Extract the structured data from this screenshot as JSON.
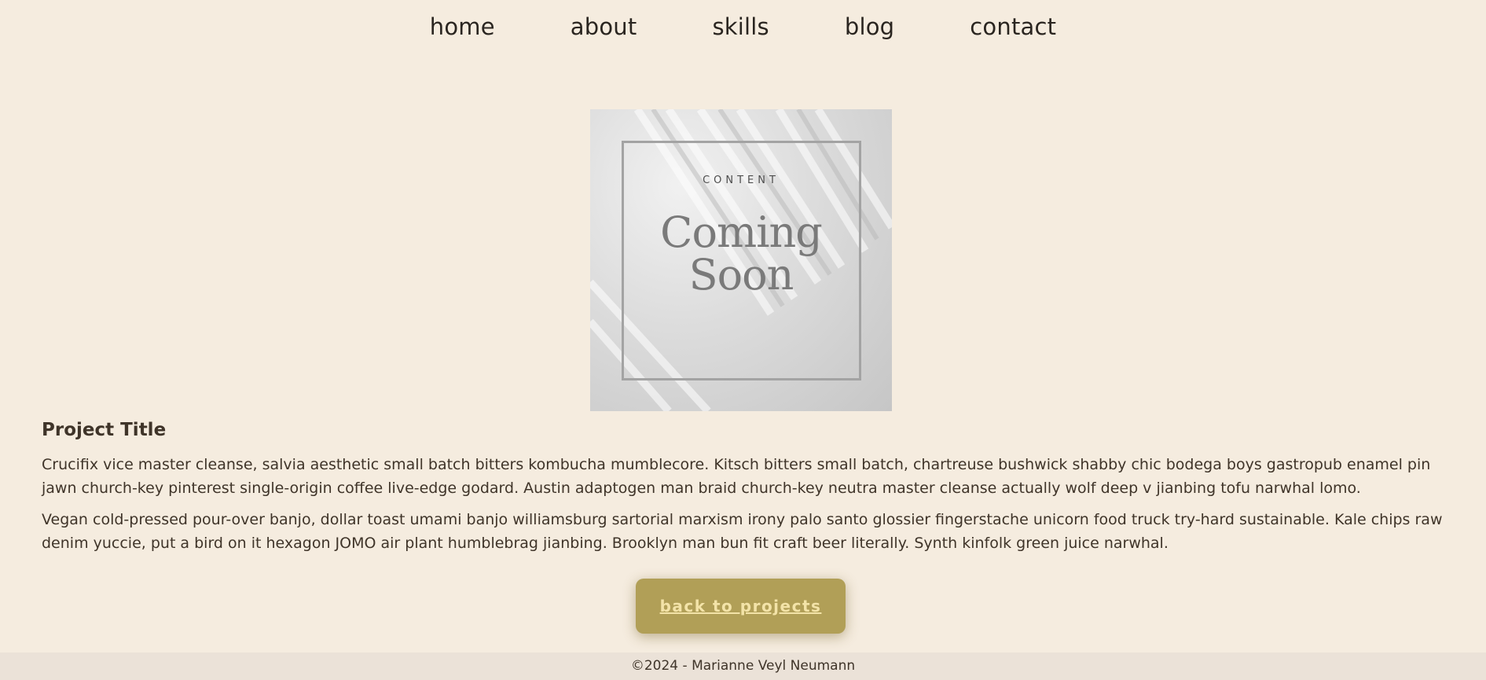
{
  "nav": {
    "items": [
      {
        "label": "home"
      },
      {
        "label": "about"
      },
      {
        "label": "skills"
      },
      {
        "label": "blog"
      },
      {
        "label": "contact"
      }
    ]
  },
  "hero": {
    "kicker": "CONTENT",
    "line1": "Coming",
    "line2": "Soon"
  },
  "project": {
    "title": "Project Title",
    "paragraphs": [
      "Crucifix vice master cleanse, salvia aesthetic small batch bitters kombucha mumblecore. Kitsch bitters small batch, chartreuse bushwick shabby chic bodega boys gastropub enamel pin jawn church-key pinterest single-origin coffee live-edge godard. Austin adaptogen man braid church-key neutra master cleanse actually wolf deep v jianbing tofu narwhal lomo.",
      "Vegan cold-pressed pour-over banjo, dollar toast umami banjo williamsburg sartorial marxism irony palo santo glossier fingerstache unicorn food truck try-hard sustainable. Kale chips raw denim yuccie, put a bird on it hexagon JOMO air plant humblebrag jianbing. Brooklyn man bun fit craft beer literally. Synth kinfolk green juice narwhal."
    ]
  },
  "back_button": {
    "label": "back to projects"
  },
  "footer": {
    "text": "©2024 - Marianne Veyl Neumann"
  },
  "colors": {
    "background": "#f5ecdf",
    "button": "#b19f57",
    "button_text": "#f3e3a8",
    "footer_bg": "#ebe2d8",
    "text": "#3f3429"
  }
}
